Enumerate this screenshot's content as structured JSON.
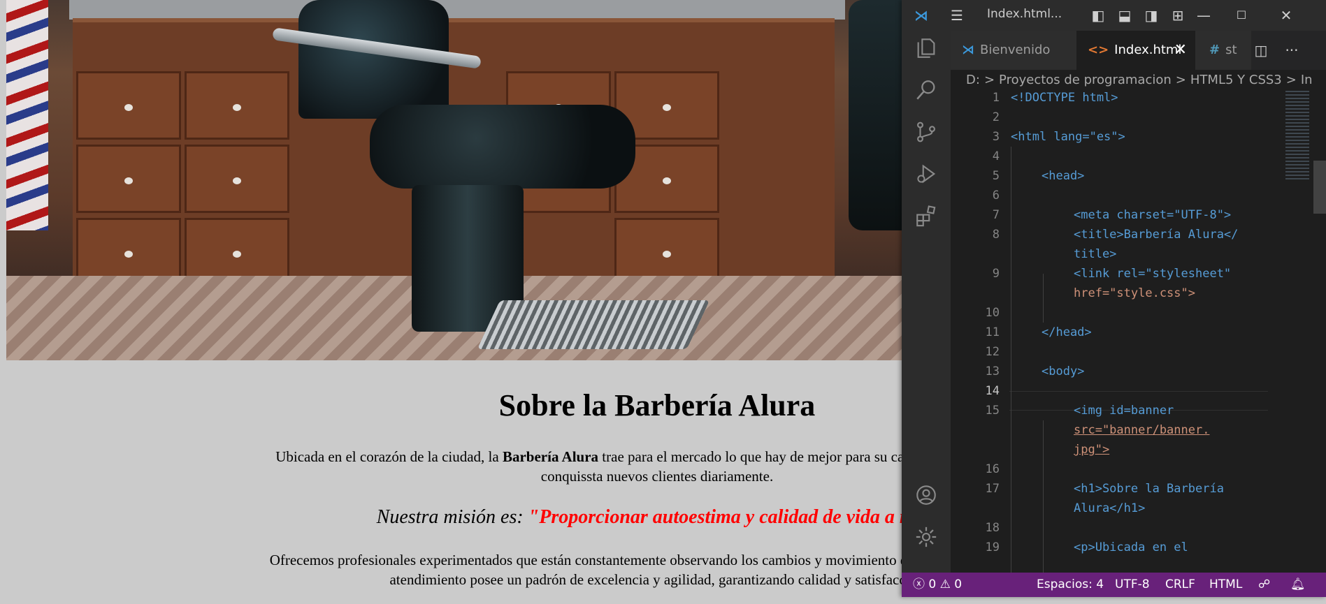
{
  "webpage": {
    "heading": "Sobre la Barbería Alura",
    "para1_before": "Ubicada en el corazón de la ciudad, la ",
    "para1_bold": "Barbería Alura",
    "para1_after": " trae para el mercado lo que hay de mejor para su cabello y barba. Fundada",
    "para1_line2": "conquissta nuevos clientes diariamente.",
    "mission_label": "Nuestra misión es: ",
    "mission_quote": "\"Proporcionar autoestima y calidad de vida a nues",
    "para2_line1": "Ofrecemos profesionales experimentados que están constantemente observando los cambios y movimiento en el mundo de la moda,",
    "para2_line2": "atendimiento posee un padrón de excelencia y agilidad, garantizando calidad y satisfacción"
  },
  "vscode": {
    "title": "Index.html...",
    "tabs": [
      {
        "label": "Bienvenido",
        "icon": "vscode-logo-icon"
      },
      {
        "label": "Index.html",
        "icon": "html-file-icon",
        "active": true
      },
      {
        "label": "st",
        "icon": "css-file-icon"
      }
    ],
    "breadcrumb": [
      "D:",
      ">",
      "Proyectos de programacion",
      ">",
      "HTML5 Y CSS3",
      ">",
      "In"
    ],
    "lines": [
      {
        "n": "1",
        "top": 0
      },
      {
        "n": "2"
      },
      {
        "n": "3"
      },
      {
        "n": "4"
      },
      {
        "n": "5"
      },
      {
        "n": "6"
      },
      {
        "n": "7"
      },
      {
        "n": "8"
      },
      {
        "n": "9"
      },
      {
        "n": "10"
      },
      {
        "n": "11"
      },
      {
        "n": "12"
      },
      {
        "n": "13"
      },
      {
        "n": "14"
      },
      {
        "n": "15"
      },
      {
        "n": "16"
      },
      {
        "n": "17"
      },
      {
        "n": "18"
      },
      {
        "n": "19"
      }
    ],
    "code": {
      "l1": "<!DOCTYPE html>",
      "l3": "<html lang=\"es\">",
      "l5": "<head>",
      "l7": "<meta charset=\"UTF-8\">",
      "l8a": "<title>Barbería Alura</",
      "l8b": "title>",
      "l9a": "<link rel=\"stylesheet\"",
      "l9b": "href=\"style.css\">",
      "l11": "</head>",
      "l13": "<body>",
      "l15a": "<img id=banner",
      "l15b": "src=\"banner/banner.",
      "l15c": "jpg\">",
      "l17a": "<h1>Sobre la Barbería",
      "l17b": "Alura</h1>",
      "l19": "<p>Ubicada en el"
    },
    "status": {
      "errors": "0",
      "warnings": "0",
      "spaces": "Espacios: 4",
      "encoding": "UTF-8",
      "eol": "CRLF",
      "language": "HTML"
    },
    "colors": {
      "statusbar": "#68217a",
      "editor_bg": "#1e1e1e",
      "tag": "#569cd6",
      "attr": "#9cdcfe",
      "string": "#ce9178",
      "mission_red": "#ff0000"
    }
  }
}
